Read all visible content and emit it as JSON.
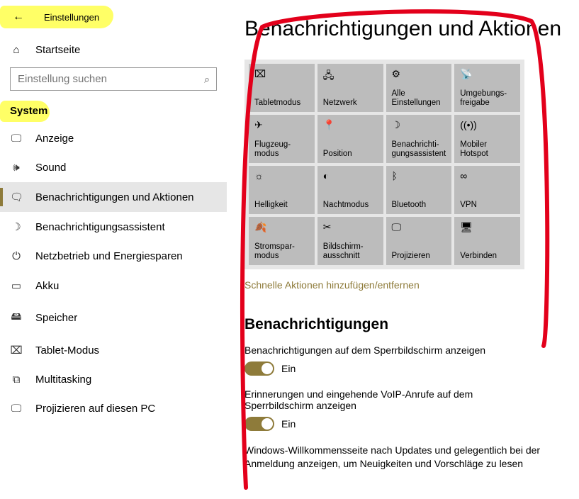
{
  "header": {
    "app_title": "Einstellungen"
  },
  "home": {
    "label": "Startseite"
  },
  "search": {
    "placeholder": "Einstellung suchen"
  },
  "section": {
    "title": "System"
  },
  "nav": [
    {
      "label": "Anzeige",
      "icon": "display-icon"
    },
    {
      "label": "Sound",
      "icon": "sound-icon"
    },
    {
      "label": "Benachrichtigungen und Aktionen",
      "icon": "notifications-icon",
      "selected": true
    },
    {
      "label": "Benachrichtigungsassistent",
      "icon": "focus-assist-icon"
    },
    {
      "label": "Netzbetrieb und Energiesparen",
      "icon": "power-icon"
    },
    {
      "label": "Akku",
      "icon": "battery-icon"
    },
    {
      "label": "Speicher",
      "icon": "storage-icon"
    },
    {
      "label": "Tablet-Modus",
      "icon": "tablet-icon"
    },
    {
      "label": "Multitasking",
      "icon": "multitasking-icon"
    },
    {
      "label": "Projizieren auf diesen PC",
      "icon": "project-icon"
    }
  ],
  "main": {
    "title": "Benachrichtigungen und Aktionen",
    "quick_actions": [
      {
        "label": "Tabletmodus",
        "icon": "tablet-icon"
      },
      {
        "label": "Netzwerk",
        "icon": "network-icon"
      },
      {
        "label": "Alle Einstellungen",
        "icon": "gear-icon"
      },
      {
        "label": "Umgebungs-freigabe",
        "icon": "nearby-share-icon"
      },
      {
        "label": "Flugzeug-modus",
        "icon": "airplane-icon"
      },
      {
        "label": "Position",
        "icon": "location-icon"
      },
      {
        "label": "Benachrichti-gungsassistent",
        "icon": "moon-icon"
      },
      {
        "label": "Mobiler Hotspot",
        "icon": "hotspot-icon"
      },
      {
        "label": "Helligkeit",
        "icon": "brightness-icon"
      },
      {
        "label": "Nachtmodus",
        "icon": "night-light-icon"
      },
      {
        "label": "Bluetooth",
        "icon": "bluetooth-icon"
      },
      {
        "label": "VPN",
        "icon": "vpn-icon"
      },
      {
        "label": "Stromspar-modus",
        "icon": "battery-saver-icon"
      },
      {
        "label": "Bildschirm-ausschnitt",
        "icon": "snip-icon"
      },
      {
        "label": "Projizieren",
        "icon": "project-icon"
      },
      {
        "label": "Verbinden",
        "icon": "connect-icon"
      }
    ],
    "qa_link": "Schnelle Aktionen hinzufügen/entfernen",
    "notif_section": "Benachrichtigungen",
    "settings": [
      {
        "label": "Benachrichtigungen auf dem Sperrbildschirm anzeigen",
        "state": "Ein"
      },
      {
        "label": "Erinnerungen und eingehende VoIP-Anrufe auf dem Sperrbildschirm anzeigen",
        "state": "Ein"
      }
    ],
    "trailing_text": "Windows-Willkommensseite nach Updates und gelegentlich bei der Anmeldung anzeigen, um Neuigkeiten und Vorschläge zu lesen"
  },
  "icons": {
    "display-icon": "🖵",
    "sound-icon": "🕪",
    "notifications-icon": "🗨",
    "focus-assist-icon": "☽",
    "power-icon": "⏻",
    "battery-icon": "▭",
    "storage-icon": "🖴",
    "tablet-icon": "⌧",
    "multitasking-icon": "⧉",
    "project-icon": "🖵",
    "network-icon": "🖧",
    "gear-icon": "⚙",
    "nearby-share-icon": "📡",
    "airplane-icon": "✈",
    "location-icon": "📍",
    "moon-icon": "☽",
    "hotspot-icon": "((•))",
    "brightness-icon": "☼",
    "night-light-icon": "◐",
    "bluetooth-icon": "ᛒ",
    "vpn-icon": "∞",
    "battery-saver-icon": "🍂",
    "snip-icon": "✂",
    "connect-icon": "🖥",
    "home-icon": "⌂",
    "search-icon": "⌕",
    "back-icon": "←"
  }
}
